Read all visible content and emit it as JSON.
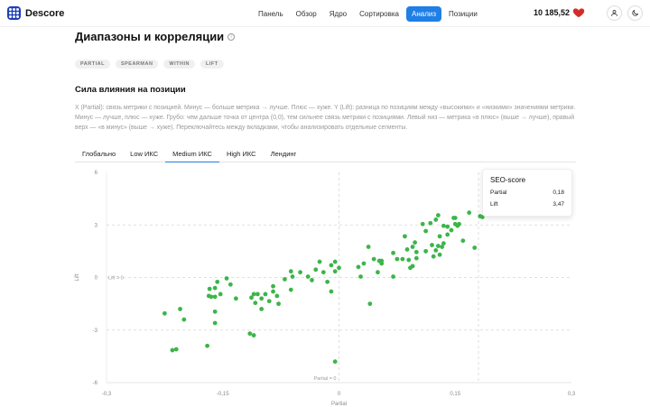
{
  "app": {
    "name": "Descore"
  },
  "nav": {
    "items": [
      {
        "label": "Панель",
        "active": false
      },
      {
        "label": "Обзор",
        "active": false
      },
      {
        "label": "Ядро",
        "active": false
      },
      {
        "label": "Сортировка",
        "active": false
      },
      {
        "label": "Анализ",
        "active": true
      },
      {
        "label": "Позиции",
        "active": false
      }
    ]
  },
  "header": {
    "balance": "10 185,52",
    "heart_icon": "heart-icon",
    "user_icon": "user-icon",
    "theme_icon": "moon-icon"
  },
  "page": {
    "title": "Диапазоны и корреляции",
    "info_icon": "info-icon",
    "chips": [
      "PARTIAL",
      "SPEARMAN",
      "WITHIN",
      "LIFT"
    ]
  },
  "section": {
    "title": "Сила влияния на позиции",
    "description": "X (Partial): связь метрики с позицией. Минус — больше метрика → лучше. Плюс — хуже. Y (Lift): разница по позициям между «высокими» и «низкими» значениями метрики. Минус — лучше, плюс — хуже. Грубо: чем дальше точка от центра (0,0), тем сильнее связь метрики с позициями. Левый низ — метрика «в плюс» (выше → лучше), правый верх — «в минус» (выше → хуже). Переключайтесь между вкладками, чтобы анализировать отдельные сегменты."
  },
  "tabs": [
    {
      "label": "Глобально",
      "active": false
    },
    {
      "label": "Low ИКС",
      "active": false
    },
    {
      "label": "Medium ИКС",
      "active": true
    },
    {
      "label": "High ИКС",
      "active": false
    },
    {
      "label": "Лендинг",
      "active": false
    }
  ],
  "tooltip": {
    "title": "SEO-score",
    "rows": [
      {
        "label": "Partial",
        "value": "0,18"
      },
      {
        "label": "Lift",
        "value": "3,47"
      }
    ]
  },
  "colors": {
    "accent": "#1f7fe6",
    "point": "#3cb54a",
    "logo": "#1f3fb8",
    "heart": "#d62b2b"
  },
  "chart_data": {
    "type": "scatter",
    "xlabel": "Partial",
    "ylabel": "Lift",
    "xlim": [
      -0.3,
      0.3
    ],
    "ylim": [
      -6,
      6
    ],
    "x_ticks": [
      "-0,3",
      "-0,15",
      "0",
      "0,15",
      "0,3"
    ],
    "y_ticks": [
      "6",
      "3",
      "0",
      "-3",
      "-6"
    ],
    "ref_labels": {
      "y": "Lift = 0",
      "x": "Partial = 0"
    },
    "grid": false,
    "series": [
      {
        "values": [
          [
            -0.225,
            -2.05
          ],
          [
            -0.215,
            -4.15
          ],
          [
            -0.21,
            -4.1
          ],
          [
            -0.205,
            -1.8
          ],
          [
            -0.2,
            -2.4
          ],
          [
            -0.168,
            -1.05
          ],
          [
            -0.165,
            -1.1
          ],
          [
            -0.17,
            -3.9
          ],
          [
            -0.167,
            -0.65
          ],
          [
            -0.16,
            -1.1
          ],
          [
            -0.16,
            -1.95
          ],
          [
            -0.16,
            -2.6
          ],
          [
            -0.16,
            -0.6
          ],
          [
            -0.157,
            -0.25
          ],
          [
            -0.153,
            -0.95
          ],
          [
            -0.145,
            -0.05
          ],
          [
            -0.14,
            -0.4
          ],
          [
            -0.133,
            -1.2
          ],
          [
            -0.113,
            -1.15
          ],
          [
            -0.11,
            -0.95
          ],
          [
            -0.108,
            -1.45
          ],
          [
            -0.105,
            -0.95
          ],
          [
            -0.115,
            -3.2
          ],
          [
            -0.11,
            -3.3
          ],
          [
            -0.1,
            -1.2
          ],
          [
            -0.095,
            -0.95
          ],
          [
            -0.09,
            -1.35
          ],
          [
            -0.1,
            -1.8
          ],
          [
            -0.085,
            -0.5
          ],
          [
            -0.085,
            -0.8
          ],
          [
            -0.08,
            -1.05
          ],
          [
            -0.07,
            -0.1
          ],
          [
            -0.062,
            0.35
          ],
          [
            -0.062,
            -0.7
          ],
          [
            -0.06,
            0.05
          ],
          [
            -0.05,
            0.3
          ],
          [
            -0.04,
            0.05
          ],
          [
            -0.035,
            -0.15
          ],
          [
            -0.03,
            0.45
          ],
          [
            -0.025,
            0.9
          ],
          [
            -0.02,
            0.3
          ],
          [
            -0.015,
            -0.25
          ],
          [
            -0.01,
            0.7
          ],
          [
            -0.005,
            0.9
          ],
          [
            -0.01,
            -0.8
          ],
          [
            -0.005,
            0.35
          ],
          [
            0.0,
            0.55
          ],
          [
            0.025,
            0.6
          ],
          [
            0.028,
            0.05
          ],
          [
            0.032,
            0.8
          ],
          [
            0.038,
            1.75
          ],
          [
            0.045,
            1.05
          ],
          [
            0.05,
            0.3
          ],
          [
            0.052,
            0.95
          ],
          [
            0.055,
            0.95
          ],
          [
            0.055,
            0.8
          ],
          [
            0.07,
            0.05
          ],
          [
            0.07,
            1.4
          ],
          [
            0.075,
            1.05
          ],
          [
            0.082,
            1.05
          ],
          [
            0.085,
            2.35
          ],
          [
            0.088,
            1.6
          ],
          [
            0.09,
            1.0
          ],
          [
            0.092,
            0.55
          ],
          [
            0.095,
            0.65
          ],
          [
            0.095,
            1.75
          ],
          [
            0.098,
            2.0
          ],
          [
            0.1,
            1.45
          ],
          [
            0.1,
            1.1
          ],
          [
            0.108,
            3.05
          ],
          [
            0.112,
            2.65
          ],
          [
            0.112,
            1.5
          ],
          [
            0.118,
            3.1
          ],
          [
            0.12,
            1.85
          ],
          [
            0.122,
            1.2
          ],
          [
            0.125,
            1.55
          ],
          [
            0.125,
            3.3
          ],
          [
            0.128,
            3.55
          ],
          [
            0.13,
            2.35
          ],
          [
            0.133,
            1.75
          ],
          [
            0.135,
            1.95
          ],
          [
            0.13,
            1.3
          ],
          [
            0.135,
            2.95
          ],
          [
            0.14,
            2.45
          ],
          [
            0.14,
            2.9
          ],
          [
            0.145,
            2.7
          ],
          [
            0.148,
            3.4
          ],
          [
            0.15,
            3.4
          ],
          [
            0.153,
            2.95
          ],
          [
            0.15,
            3.05
          ],
          [
            0.155,
            3.05
          ],
          [
            0.16,
            2.1
          ],
          [
            0.168,
            3.7
          ],
          [
            0.175,
            1.7
          ],
          [
            0.185,
            3.45
          ],
          [
            0.182,
            3.5
          ],
          [
            0.128,
            1.8
          ],
          [
            -0.005,
            -4.8
          ],
          [
            -0.078,
            -1.5
          ],
          [
            0.04,
            -1.5
          ]
        ]
      }
    ]
  }
}
